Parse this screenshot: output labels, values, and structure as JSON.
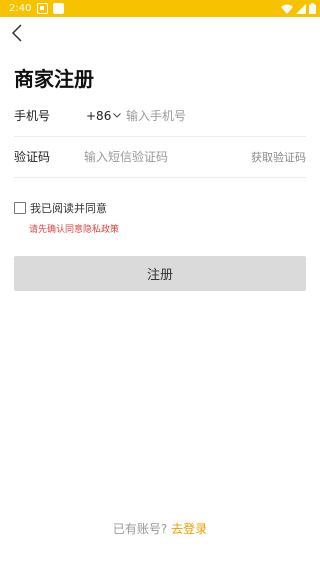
{
  "status_bar": {
    "time": "2:40",
    "background": "#f7c300",
    "icons": [
      "notification-icon",
      "notification-icon",
      "wifi-icon",
      "signal-icon",
      "battery-icon"
    ]
  },
  "nav": {
    "back_icon": "back-chevron-icon"
  },
  "page": {
    "title": "商家注册"
  },
  "form": {
    "phone": {
      "label": "手机号",
      "country_code": "+86",
      "placeholder": "输入手机号",
      "value": ""
    },
    "code": {
      "label": "验证码",
      "placeholder": "输入短信验证码",
      "value": "",
      "get_code_label": "获取验证码"
    }
  },
  "agreement": {
    "label": "我已阅读并同意",
    "checked": false,
    "warning": "请先确认同意隐私政策",
    "warning_color": "#e04343"
  },
  "submit": {
    "label": "注册",
    "background": "#dadada"
  },
  "footer": {
    "prompt": "已有账号?",
    "login_link": "去登录",
    "link_color": "#f0a000"
  }
}
